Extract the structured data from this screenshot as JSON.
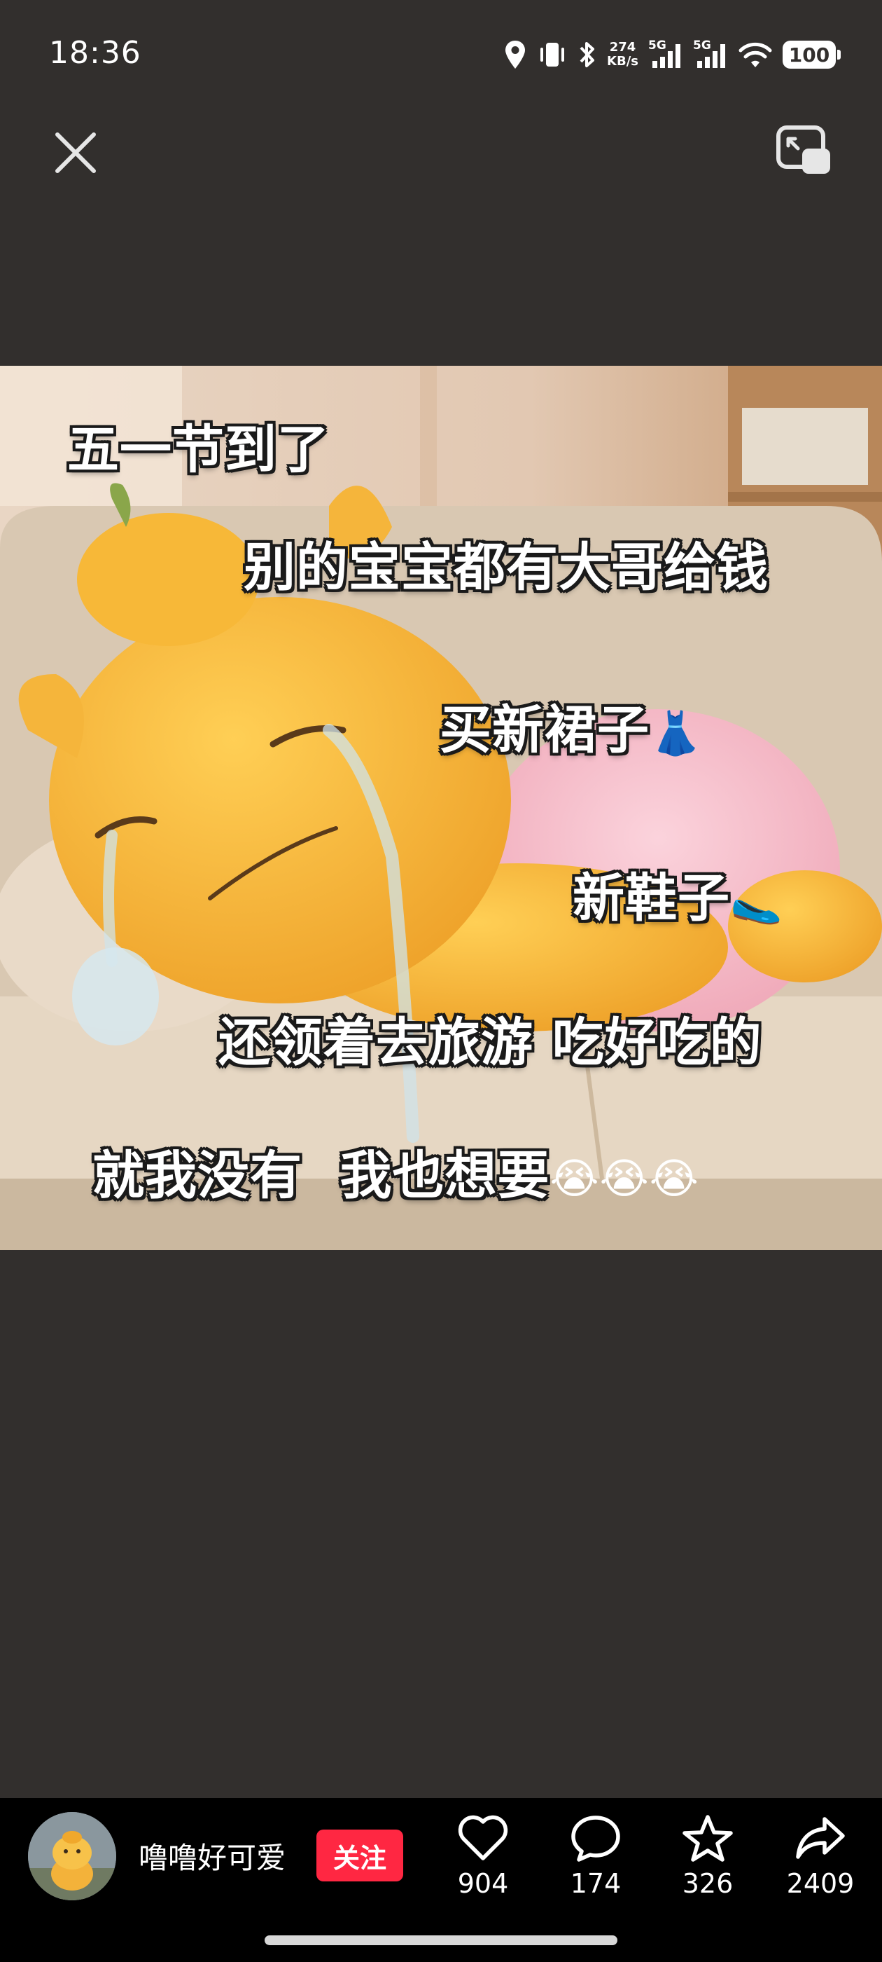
{
  "status_bar": {
    "time": "18:36",
    "net_speed_value": "274",
    "net_speed_unit": "KB/s",
    "signal1_label": "5G",
    "signal2_label": "5G",
    "battery": "100",
    "icons": [
      "location-icon",
      "vibrate-icon",
      "bluetooth-icon",
      "signal-icon",
      "wifi-icon",
      "battery-icon"
    ]
  },
  "top_controls": {
    "close_icon": "close-icon",
    "pip_icon": "picture-in-picture-icon"
  },
  "post_image": {
    "captions": [
      "五一节到了",
      "别的宝宝都有大哥给钱",
      "买新裙子",
      "新鞋子",
      "还领着去旅游 吃好吃的",
      "就我没有  我也想要"
    ],
    "caption_emojis": {
      "dress": "👗",
      "shoe": "🥿",
      "crying": "😭😭😭"
    }
  },
  "author": {
    "name": "噜噜好可爱",
    "follow_label": "关注"
  },
  "actions": {
    "like_count": "904",
    "comment_count": "174",
    "favorite_count": "326",
    "share_count": "2409"
  },
  "colors": {
    "page_bg": "#322f2d",
    "bottom_bar_bg": "#000000",
    "follow_button": "#ff2742",
    "text": "#ffffff"
  }
}
